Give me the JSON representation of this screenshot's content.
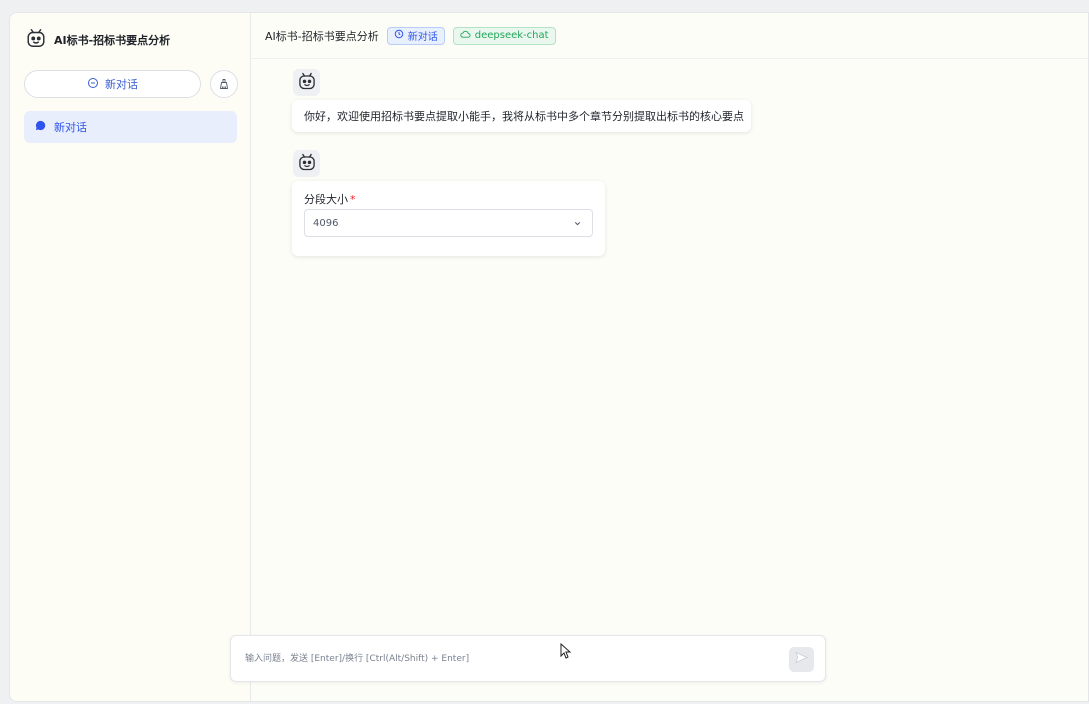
{
  "sidebar": {
    "brand_title": "AI标书-招标书要点分析",
    "new_chat_label": "新对话",
    "conversations": [
      {
        "label": "新对话",
        "active": true
      }
    ]
  },
  "topbar": {
    "title": "AI标书-招标书要点分析",
    "conversation_tag": "新对话",
    "model_tag": "deepseek-chat"
  },
  "messages": [
    {
      "role": "assistant",
      "text": "你好，欢迎使用招标书要点提取小能手，我将从标书中多个章节分别提取出标书的核心要点"
    }
  ],
  "form": {
    "label": "分段大小",
    "required_mark": "*",
    "selected_value": "4096"
  },
  "composer": {
    "placeholder": "输入问题，发送 [Enter]/换行 [Ctrl(Alt/Shift) + Enter]"
  },
  "icons": {
    "brand": "robot-icon",
    "new_chat": "chat-bubble-icon",
    "clear": "broom-icon",
    "conversation": "chat-dot-icon",
    "tag_clock": "clock-icon",
    "tag_model": "cloud-icon",
    "select": "chevron-down-icon",
    "send": "send-icon"
  },
  "colors": {
    "accent": "#2f54eb",
    "tag_green": "#22a55a",
    "required": "#f5222d"
  }
}
